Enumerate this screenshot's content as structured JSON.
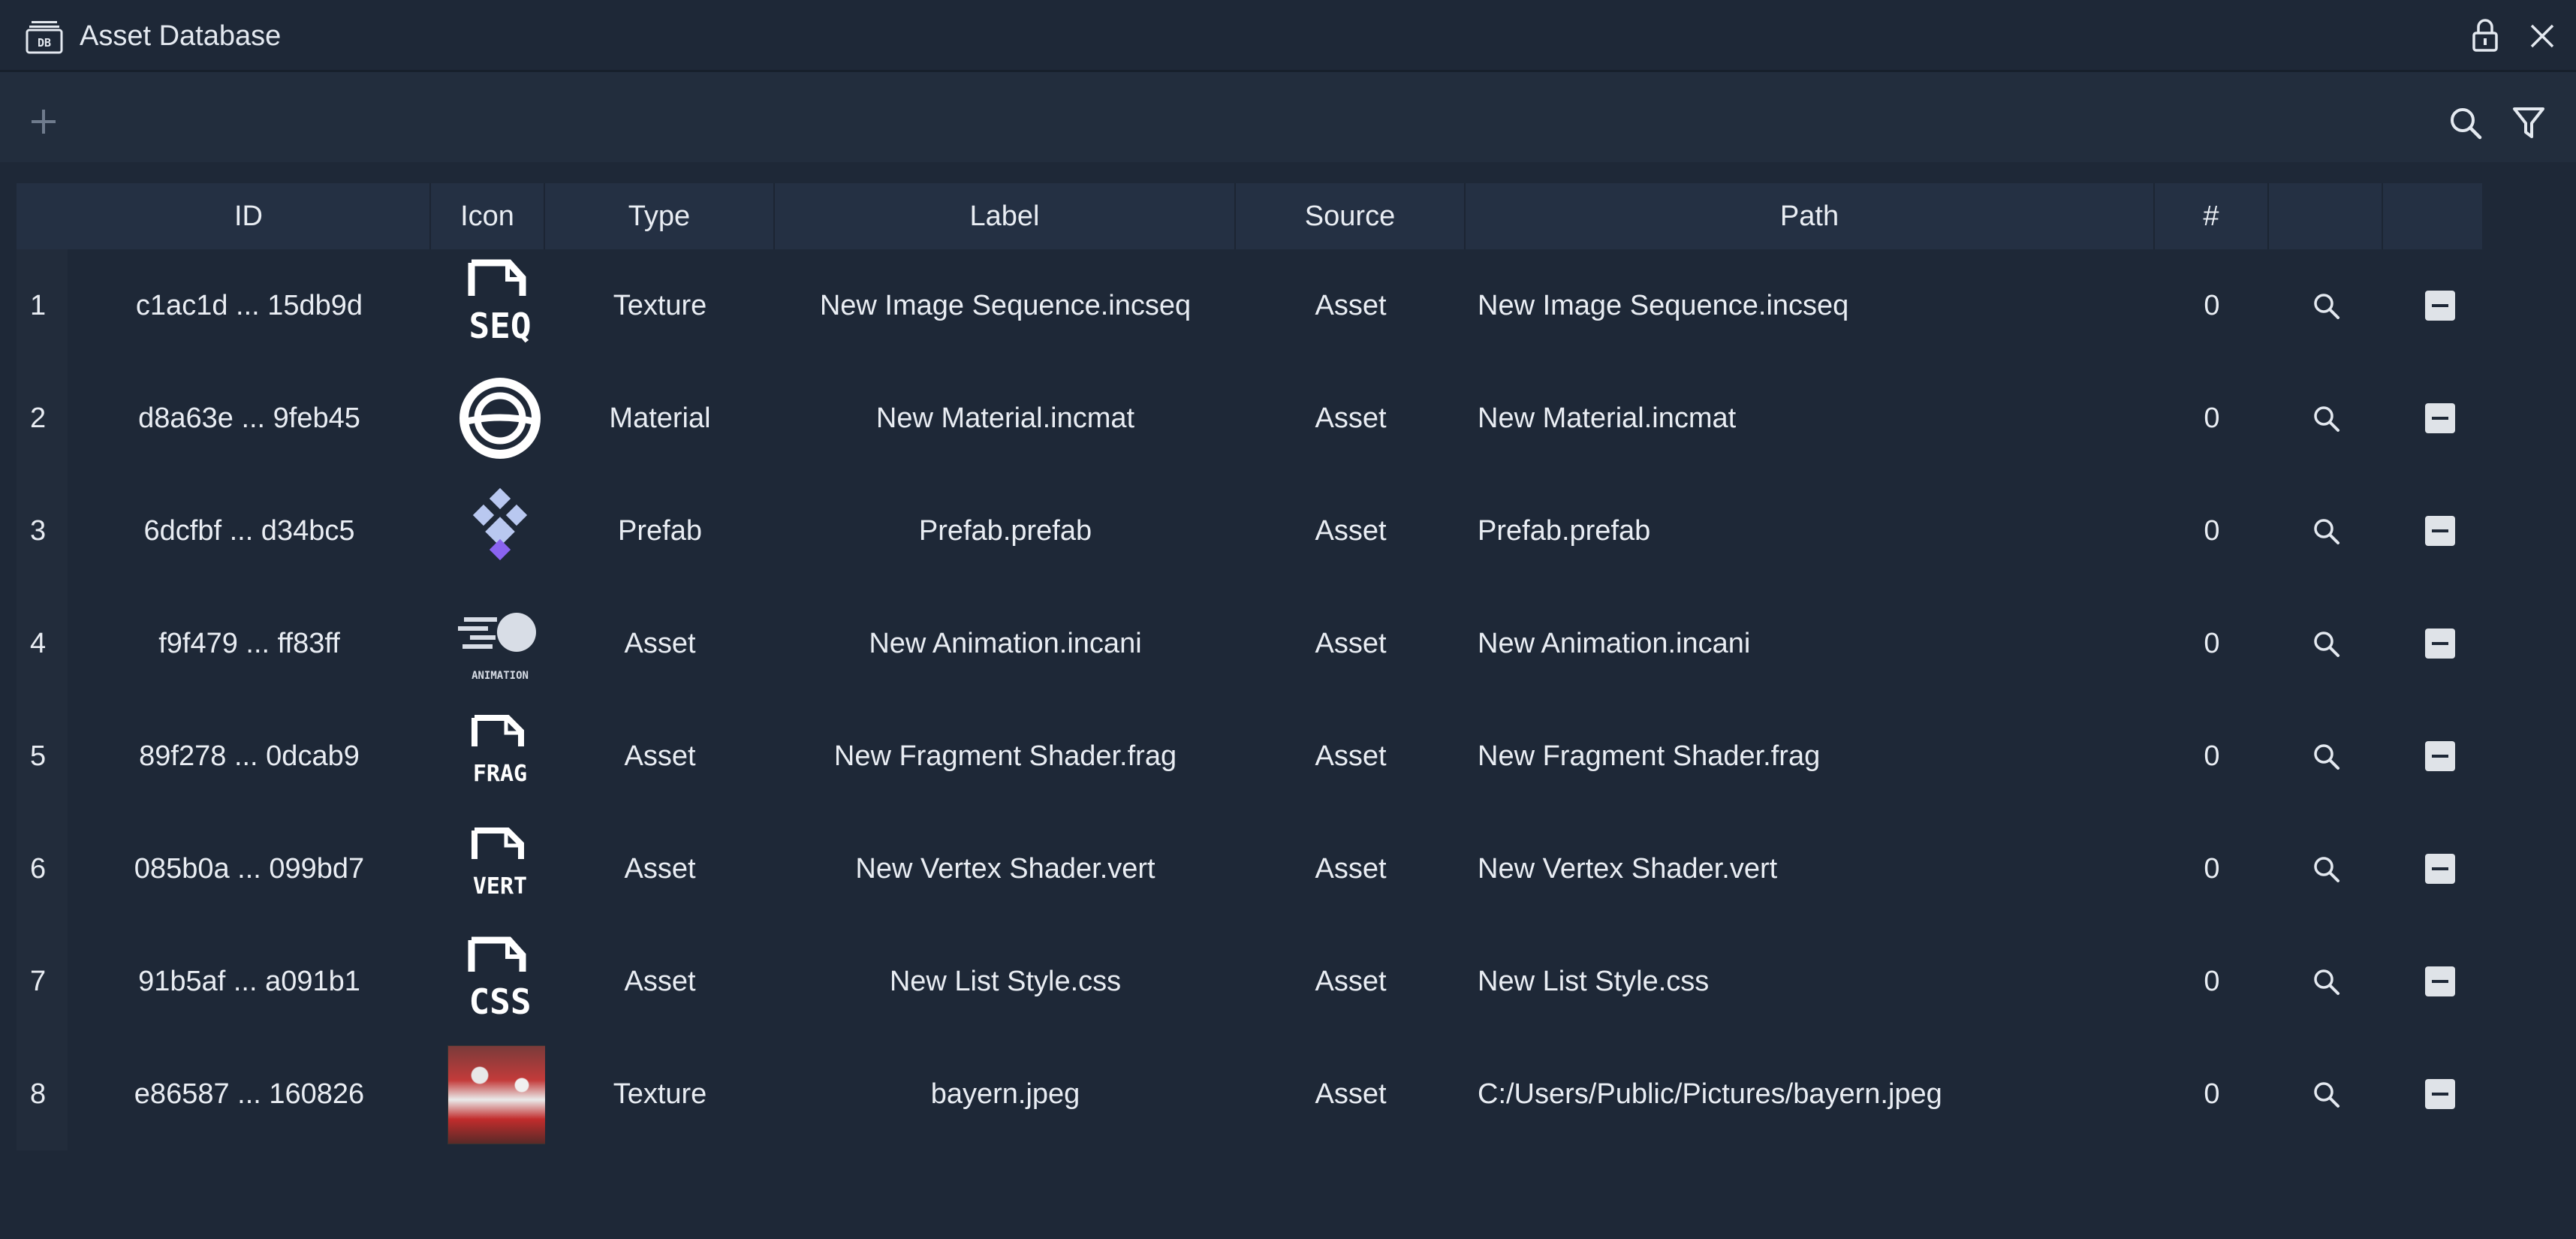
{
  "window": {
    "title": "Asset Database",
    "title_icon": "database-icon",
    "lock_icon": "lock-icon",
    "close_icon": "close-icon"
  },
  "toolbar": {
    "add_icon": "plus-icon",
    "search_icon": "search-icon",
    "filter_icon": "filter-icon"
  },
  "table": {
    "columns": [
      "ID",
      "Icon",
      "Type",
      "Label",
      "Source",
      "Path",
      "#",
      "",
      ""
    ],
    "rows": [
      {
        "num": "1",
        "id": "c1ac1d ... 15db9d",
        "icon": "seq-file-icon",
        "type": "Texture",
        "label": "New Image Sequence.incseq",
        "source": "Asset",
        "path": "New Image Sequence.incseq",
        "count": "0"
      },
      {
        "num": "2",
        "id": "d8a63e ... 9feb45",
        "icon": "material-icon",
        "type": "Material",
        "label": "New Material.incmat",
        "source": "Asset",
        "path": "New Material.incmat",
        "count": "0"
      },
      {
        "num": "3",
        "id": "6dcfbf ... d34bc5",
        "icon": "prefab-icon",
        "type": "Prefab",
        "label": "Prefab.prefab",
        "source": "Asset",
        "path": "Prefab.prefab",
        "count": "0"
      },
      {
        "num": "4",
        "id": "f9f479 ... ff83ff",
        "icon": "animation-icon",
        "type": "Asset",
        "label": "New Animation.incani",
        "source": "Asset",
        "path": "New Animation.incani",
        "count": "0"
      },
      {
        "num": "5",
        "id": "89f278 ... 0dcab9",
        "icon": "frag-file-icon",
        "type": "Asset",
        "label": "New Fragment Shader.frag",
        "source": "Asset",
        "path": "New Fragment Shader.frag",
        "count": "0"
      },
      {
        "num": "6",
        "id": "085b0a ... 099bd7",
        "icon": "vert-file-icon",
        "type": "Asset",
        "label": "New Vertex Shader.vert",
        "source": "Asset",
        "path": "New Vertex Shader.vert",
        "count": "0"
      },
      {
        "num": "7",
        "id": "91b5af ... a091b1",
        "icon": "css-file-icon",
        "type": "Asset",
        "label": "New List Style.css",
        "source": "Asset",
        "path": "New List Style.css",
        "count": "0"
      },
      {
        "num": "8",
        "id": "e86587 ... 160826",
        "icon": "image-thumbnail",
        "type": "Texture",
        "label": "bayern.jpeg",
        "source": "Asset",
        "path": "C:/Users/Public/Pictures/bayern.jpeg",
        "count": "0"
      }
    ],
    "row_search_icon": "search-icon",
    "row_remove_icon": "minus-square-icon"
  },
  "icon_labels": {
    "seq": "SEQ",
    "frag": "FRAG",
    "vert": "VERT",
    "css": "CSS",
    "animation": "ANIMATION"
  },
  "colors": {
    "background": "#1e2837",
    "header": "#243043",
    "prefab_light": "#b9c8f0",
    "prefab_purple": "#8a63f0"
  }
}
